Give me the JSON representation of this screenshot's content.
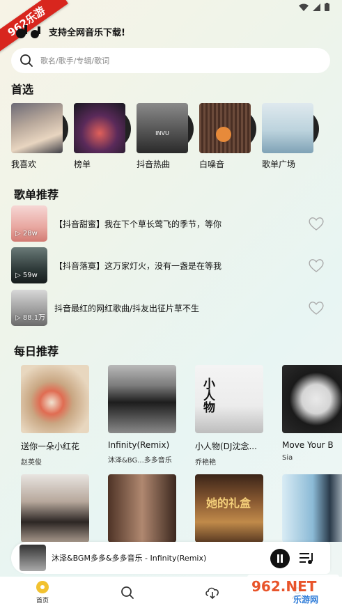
{
  "badge": "962乐游",
  "header": {
    "slogan": "支持全网音乐下载!"
  },
  "search": {
    "placeholder": "歌名/歌手/专辑/歌词"
  },
  "picks": {
    "title": "首选",
    "items": [
      {
        "label": "我喜欢"
      },
      {
        "label": "榜单"
      },
      {
        "label": "抖音热曲",
        "cover_text": "INVU"
      },
      {
        "label": "白噪音"
      },
      {
        "label": "歌单广场"
      }
    ]
  },
  "playlists": {
    "title": "歌单推荐",
    "items": [
      {
        "title": "【抖音甜蜜】我在下个草长莺飞的季节，等你",
        "count": "28w"
      },
      {
        "title": "【抖音落寞】这万家灯火，没有一盏是在等我",
        "count": "59w"
      },
      {
        "title": "抖音最红的网红歌曲/抖友出征片草不生",
        "count": "88.1万"
      }
    ]
  },
  "daily": {
    "title": "每日推荐",
    "row1": [
      {
        "title": "送你一朵小红花",
        "artist": "赵英俊"
      },
      {
        "title": "Infinity(Remix)",
        "artist": "沐泽&BG...多多音乐"
      },
      {
        "title": "小人物(DJ沈念...",
        "artist": "乔艳艳",
        "cover_text": "小人物"
      },
      {
        "title": "Move Your B",
        "artist": "Sia"
      }
    ],
    "row2": [
      {
        "title": "",
        "artist": ""
      },
      {
        "title": "",
        "artist": ""
      },
      {
        "title": "",
        "artist": "",
        "cover_text": "她的礼盒"
      },
      {
        "title": "",
        "artist": ""
      }
    ]
  },
  "player": {
    "now_playing": "沐泽&BGM多多&多多音乐 - Infinity(Remix)"
  },
  "tabs": [
    {
      "label": "首页",
      "icon": "home-disc-icon",
      "active": true
    },
    {
      "label": "",
      "icon": "search-icon"
    },
    {
      "label": "",
      "icon": "download-cloud-icon"
    },
    {
      "label": "",
      "icon": "profile-icon"
    }
  ],
  "watermark": {
    "text": "962.NET",
    "sub": "乐游网"
  },
  "colors": {
    "accent": "#f2c230",
    "badge": "#d8261e"
  }
}
